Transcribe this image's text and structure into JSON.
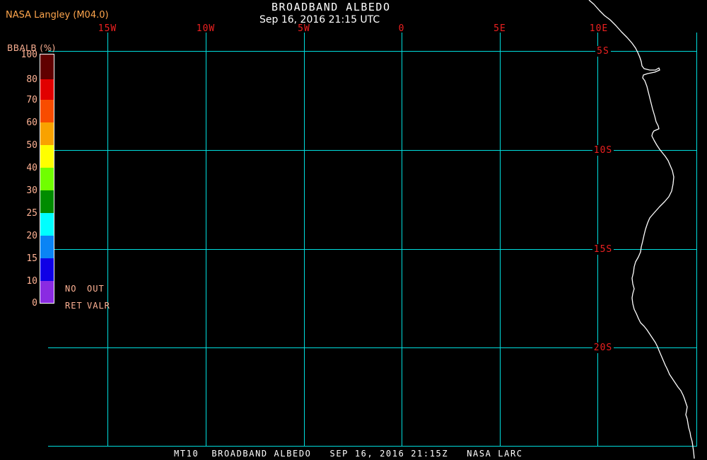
{
  "header": {
    "brand": "NASA Langley (M04.0)",
    "title": "BROADBAND ALBEDO",
    "subtitle": "Sep 16, 2016 21:15 UTC"
  },
  "colorbar": {
    "label": "BBALB (%)",
    "ticks": [
      "100",
      "80",
      "70",
      "60",
      "50",
      "40",
      "30",
      "25",
      "20",
      "15",
      "10",
      "0"
    ],
    "segments": [
      {
        "from": 80,
        "to": 100,
        "color": "#600000"
      },
      {
        "from": 70,
        "to": 80,
        "color": "#e10000"
      },
      {
        "from": 60,
        "to": 70,
        "color": "#f84c00"
      },
      {
        "from": 50,
        "to": 60,
        "color": "#f9a200"
      },
      {
        "from": 40,
        "to": 50,
        "color": "#ffff00"
      },
      {
        "from": 30,
        "to": 40,
        "color": "#70ff00"
      },
      {
        "from": 25,
        "to": 30,
        "color": "#008c00"
      },
      {
        "from": 20,
        "to": 25,
        "color": "#00ffff"
      },
      {
        "from": 15,
        "to": 20,
        "color": "#0a84f5"
      },
      {
        "from": 10,
        "to": 15,
        "color": "#0f00e6"
      },
      {
        "from": 0,
        "to": 10,
        "color": "#8a2be2"
      }
    ],
    "legend_rows": [
      [
        "NO",
        "OUT"
      ],
      [
        "RET",
        "VALR"
      ]
    ]
  },
  "map": {
    "lon_labels": [
      "15W",
      "10W",
      "5W",
      "0",
      "5E",
      "10E"
    ],
    "lat_labels": [
      "5S",
      "10S",
      "15S",
      "20S"
    ],
    "grid_color": "#00dede",
    "coast_color": "#ffffff",
    "geo_label_color": "#ee2020"
  },
  "footer": {
    "model": "MT10",
    "product": "BROADBAND ALBEDO",
    "datetime": "SEP 16, 2016 21:15Z",
    "org": "NASA LARC"
  }
}
